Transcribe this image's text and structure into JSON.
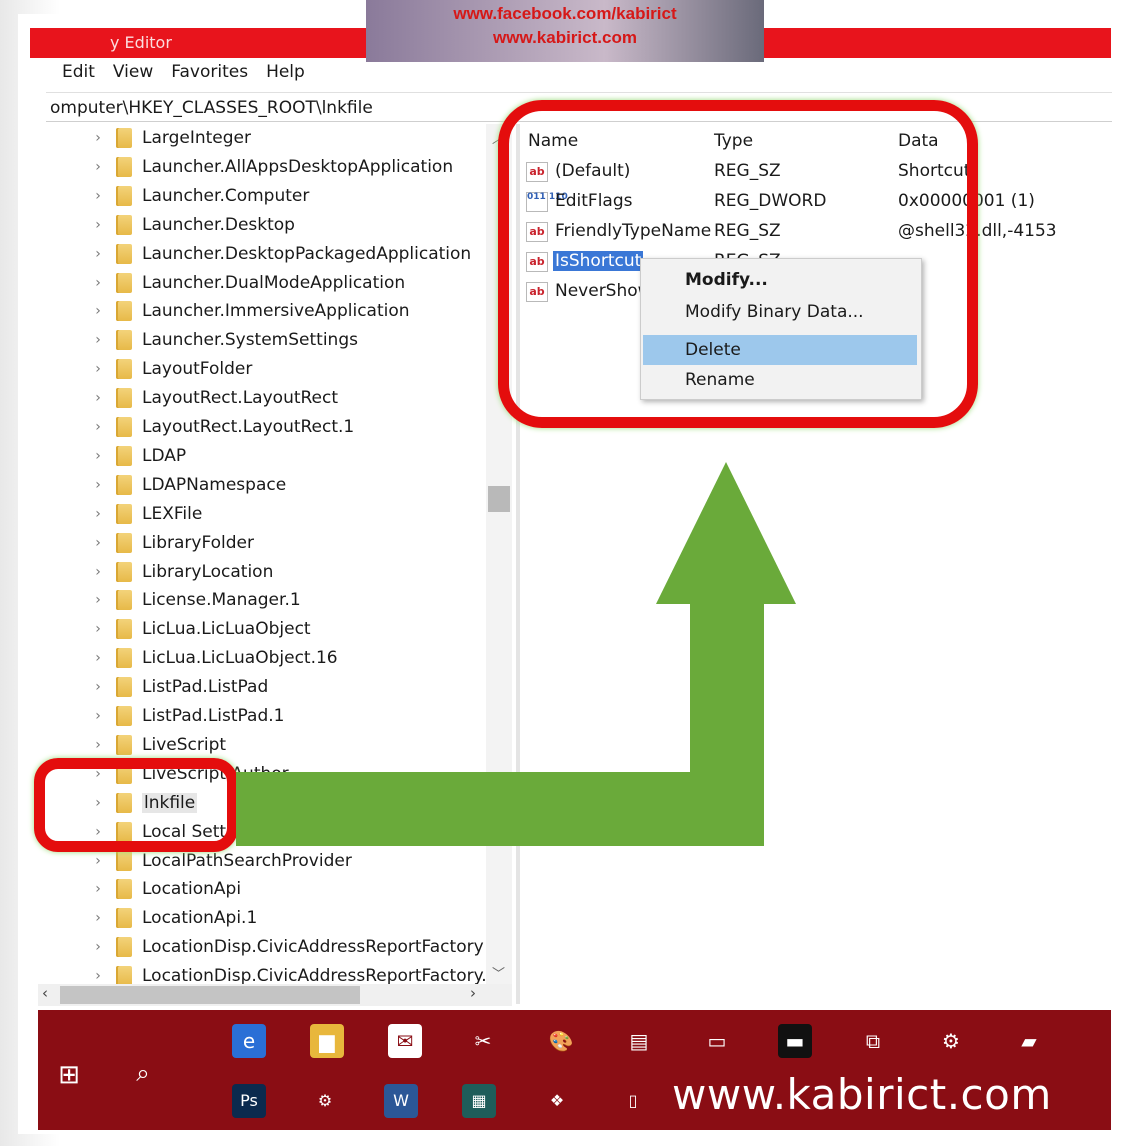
{
  "watermark": {
    "line1": "www.facebook.com/kabirict",
    "line2": "www.kabirict.com"
  },
  "window": {
    "title": "y Editor"
  },
  "menu": [
    "Edit",
    "View",
    "Favorites",
    "Help"
  ],
  "address": "omputer\\HKEY_CLASSES_ROOT\\lnkfile",
  "tree": {
    "items": [
      "LargeInteger",
      "Launcher.AllAppsDesktopApplication",
      "Launcher.Computer",
      "Launcher.Desktop",
      "Launcher.DesktopPackagedApplication",
      "Launcher.DualModeApplication",
      "Launcher.ImmersiveApplication",
      "Launcher.SystemSettings",
      "LayoutFolder",
      "LayoutRect.LayoutRect",
      "LayoutRect.LayoutRect.1",
      "LDAP",
      "LDAPNamespace",
      "LEXFile",
      "LibraryFolder",
      "LibraryLocation",
      "License.Manager.1",
      "LicLua.LicLuaObject",
      "LicLua.LicLuaObject.16",
      "ListPad.ListPad",
      "ListPad.ListPad.1",
      "LiveScript",
      "LiveScript Author",
      "lnkfile",
      "Local Settings",
      "LocalPathSearchProvider",
      "LocationApi",
      "LocationApi.1",
      "LocationDisp.CivicAddressReportFactory",
      "LocationDisp.CivicAddressReportFactory.1"
    ],
    "selected": "lnkfile"
  },
  "values": {
    "headers": {
      "name": "Name",
      "type": "Type",
      "data": "Data"
    },
    "rows": [
      {
        "icon": "ab",
        "name": "(Default)",
        "type": "REG_SZ",
        "data": "Shortcut"
      },
      {
        "icon": "bin",
        "name": "EditFlags",
        "type": "REG_DWORD",
        "data": "0x00000001 (1)"
      },
      {
        "icon": "ab",
        "name": "FriendlyTypeName",
        "type": "REG_SZ",
        "data": "@shell32.dll,-4153"
      },
      {
        "icon": "ab",
        "name": "IsShortcut",
        "type": "REG_SZ",
        "data": ""
      },
      {
        "icon": "ab",
        "name": "NeverShowExt",
        "type": "",
        "data": ""
      }
    ]
  },
  "context_menu": {
    "items": [
      "Modify...",
      "Modify Binary Data...",
      "Delete",
      "Rename"
    ],
    "highlighted": "Delete"
  },
  "taskbar": {
    "label": "www.kabirict.com",
    "icons_row1": [
      "edge-icon",
      "file-explorer-icon",
      "mail-icon",
      "snipping-tool-icon",
      "paint-icon",
      "contacts-icon",
      "remote-desktop-icon",
      "command-prompt-icon",
      "network-icon",
      "settings-icon",
      "notepad-icon"
    ],
    "icons_row2": [
      "photoshop-icon",
      "control-panel-icon",
      "word-icon",
      "media-icon",
      "registry-icon",
      "notes-icon"
    ]
  },
  "colors": {
    "titlebar": "#e8141c",
    "highlight": "#e40d0d",
    "arrow": "#6aaa3a",
    "taskbar": "#8a0d14",
    "selection": "#3a77d6"
  }
}
